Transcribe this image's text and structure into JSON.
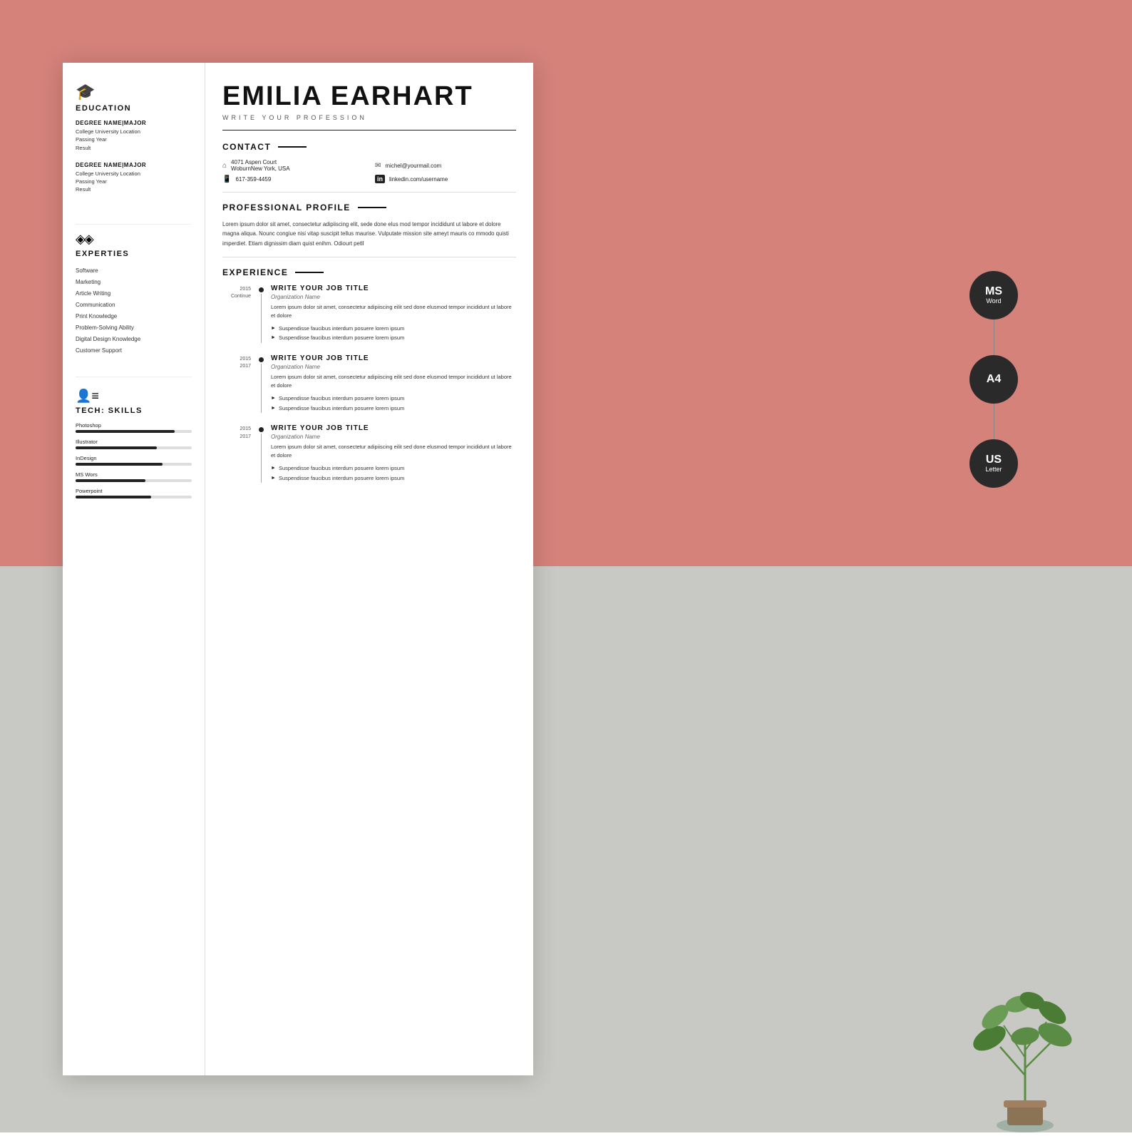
{
  "background": {
    "pink": "#d4827a",
    "gray": "#c8c8c4"
  },
  "resume": {
    "name": "EMILIA EARHART",
    "profession": "WRITE YOUR PROFESSION",
    "contact": {
      "address": "4071 Aspen Court",
      "city": "WoburnNew York, USA",
      "phone": "617-359-4459",
      "email": "michel@yourmail.com",
      "linkedin": "linkedin.com/username"
    },
    "profile": {
      "heading": "PROFESSIONAL PROFILE",
      "text": "Lorem ipsum dolor sit amet, consectetur adipiiscing elit, sede done elus mod tempor incididunt ut labore et dolore magna aliqua. Nounc congiue nisi vitap suscipit tellus maurise. Vulputate mission site ameyt mauris co mmodo quisti imperdiet. Etiam dignissim diam quist enihm. Odiourt petll"
    },
    "education": {
      "heading": "EDUCATION",
      "degrees": [
        {
          "name": "DEGREE NAME|MAJOR",
          "location": "College University Location",
          "year": "Passing Year",
          "result": "Result"
        },
        {
          "name": "DEGREE NAME|MAJOR",
          "location": "College University Location",
          "year": "Passing Year",
          "result": "Result"
        }
      ]
    },
    "experties": {
      "heading": "EXPERTIES",
      "items": [
        "Software",
        "Marketing",
        "Article Writing",
        "Communication",
        "Print Knowledge",
        "Problem-Solving Ability",
        "Digital Design Knowledge",
        "Customer Support"
      ]
    },
    "tech_skills": {
      "heading": "TECH: SKILLS",
      "skills": [
        {
          "name": "Photoshop",
          "percent": 85
        },
        {
          "name": "Illustrator",
          "percent": 70
        },
        {
          "name": "InDesign",
          "percent": 75
        },
        {
          "name": "MS Wors",
          "percent": 60
        },
        {
          "name": "Powerpoint",
          "percent": 65
        }
      ]
    },
    "experience": {
      "heading": "EXPERIENCE",
      "jobs": [
        {
          "year_start": "2015",
          "year_end": "Continue",
          "title": "WRITE YOUR JOB TITLE",
          "org": "Organization Name",
          "desc": "Lorem ipsum dolor sit amet, consectetur adipiiscing eilit sed done elusmod tempor incididunt ut labore et dolore",
          "bullets": [
            "Suspendisse faucibus interdum posuere lorem ipsum",
            "Suspendisse faucibus interdum posuere lorem ipsum"
          ]
        },
        {
          "year_start": "2015",
          "year_end": "2017",
          "title": "WRITE YOUR JOB TITLE",
          "org": "Organization Name",
          "desc": "Lorem ipsum dolor sit amet, consectetur adipiiscing eilit sed done elusmod tempor incididunt ut labore et dolore",
          "bullets": [
            "Suspendisse faucibus interdum posuere lorem ipsum",
            "Suspendisse faucibus interdum posuere lorem ipsum"
          ]
        },
        {
          "year_start": "2015",
          "year_end": "2017",
          "title": "WRITE YOUR JOB TITLE",
          "org": "Organization Name",
          "desc": "Lorem ipsum dolor sit amet, consectetur adipiiscing eilit sed done elusmod tempor incididunt ut labore et dolore",
          "bullets": [
            "Suspendisse faucibus interdum posuere lorem ipsum",
            "Suspendisse faucibus interdum posuere lorem ipsum"
          ]
        }
      ]
    }
  },
  "badges": [
    {
      "main": "MS",
      "sub": "Word"
    },
    {
      "main": "A4",
      "sub": ""
    },
    {
      "main": "US",
      "sub": "Letter"
    }
  ]
}
